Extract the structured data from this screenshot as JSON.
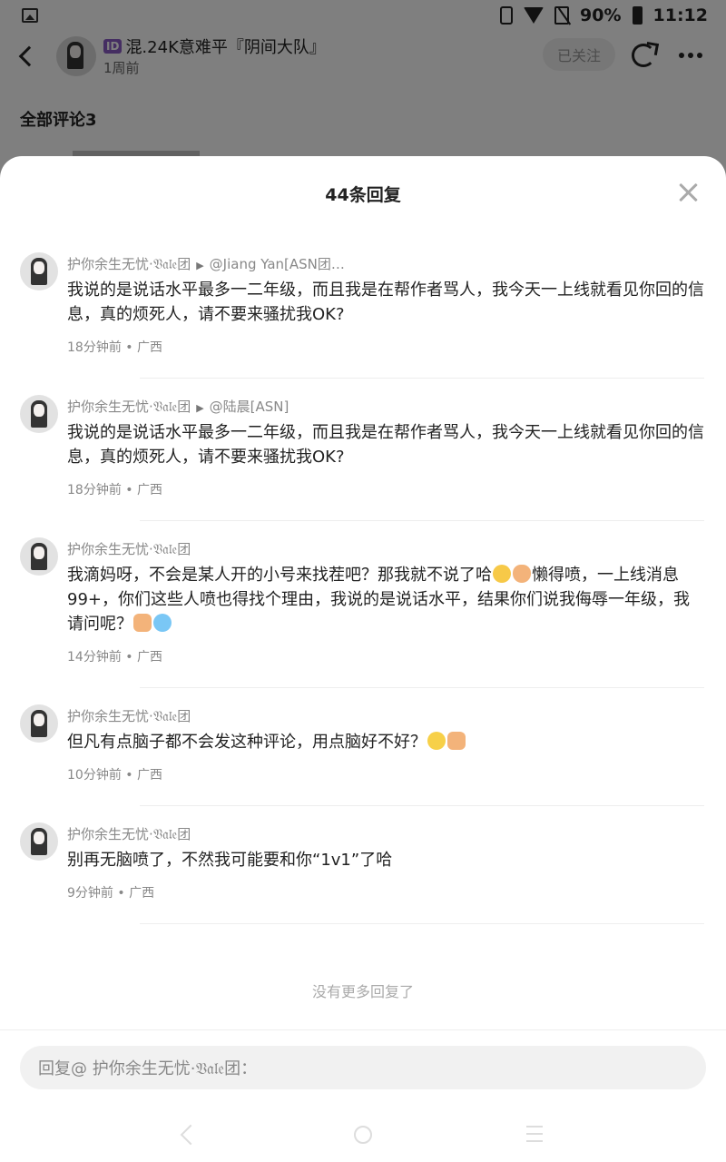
{
  "status_bar": {
    "battery": "90%",
    "time": "11:12"
  },
  "header": {
    "badge": "ID",
    "username": "混.24K意难平『阴间大队』",
    "time": "1周前",
    "follow_label": "已关注"
  },
  "background": {
    "all_comments": "全部评论3"
  },
  "sheet": {
    "title": "44条回复",
    "replies": [
      {
        "author": "护你余生无忧·𝔙𝔞𝔩𝔢团",
        "reply_to": "@Jiang Yan[ASN团…",
        "text": "我说的是说话水平最多一二年级，而且我是在帮作者骂人，我今天一上线就看见你回的信息，真的烦死人，请不要来骚扰我OK?",
        "time": "18分钟前",
        "location": "广西"
      },
      {
        "author": "护你余生无忧·𝔙𝔞𝔩𝔢团",
        "reply_to": "@陆晨[ASN]",
        "text": "我说的是说话水平最多一二年级，而且我是在帮作者骂人，我今天一上线就看见你回的信息，真的烦死人，请不要来骚扰我OK?",
        "time": "18分钟前",
        "location": "广西"
      },
      {
        "author": "护你余生无忧·𝔙𝔞𝔩𝔢团",
        "reply_to": "",
        "text_a": "我滴妈呀，不会是某人开的小号来找茬吧？那我就不说了哈",
        "text_b": "懒得喷，一上线消息99+，你们这些人喷也得找个理由，我说的是说话水平，结果你们说我侮辱一年级，我请问呢？",
        "time": "14分钟前",
        "location": "广西"
      },
      {
        "author": "护你余生无忧·𝔙𝔞𝔩𝔢团",
        "reply_to": "",
        "text": "但凡有点脑子都不会发这种评论，用点脑好不好？",
        "time": "10分钟前",
        "location": "广西"
      },
      {
        "author": "护你余生无忧·𝔙𝔞𝔩𝔢团",
        "reply_to": "",
        "text": "别再无脑喷了，不然我可能要和你“1v1”了哈",
        "time": "9分钟前",
        "location": "广西"
      }
    ],
    "no_more": "没有更多回复了",
    "input_placeholder": "回复@ 护你余生无忧·𝔙𝔞𝔩𝔢团："
  },
  "icons": {
    "overlay_color": "#000000",
    "badge_color": "#8a5cc4"
  }
}
